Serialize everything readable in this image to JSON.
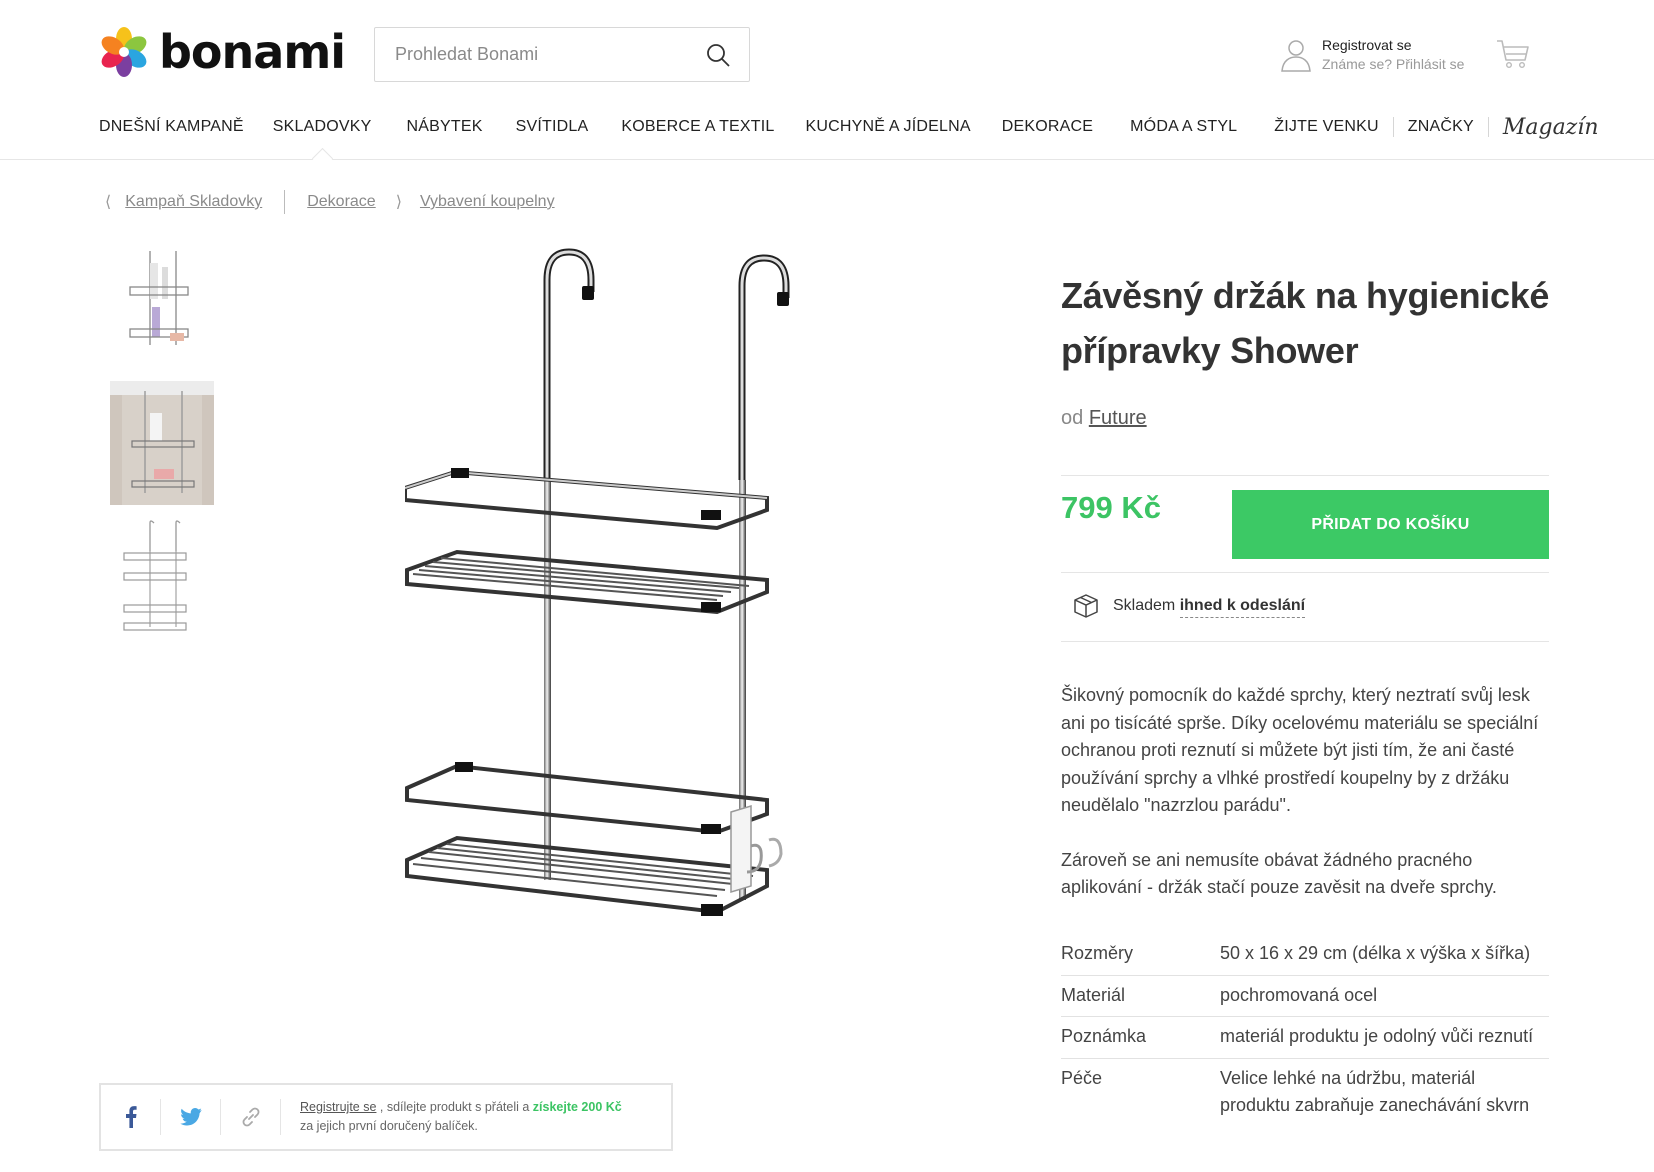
{
  "header": {
    "logo_text": "bonami",
    "search_placeholder": "Prohledat Bonami",
    "account": {
      "register": "Registrovat se",
      "login": "Známe se? Přihlásit se"
    }
  },
  "nav": {
    "items": [
      "DNEŠNÍ KAMPANĚ",
      "SKLADOVKY",
      "NÁBYTEK",
      "SVÍTIDLA",
      "KOBERCE A TEXTIL",
      "KUCHYNĚ A JÍDELNA",
      "DEKORACE",
      "MÓDA A STYL",
      "ŽIJTE VENKU",
      "ZNAČKY",
      "Magazín"
    ],
    "active": "SKLADOVKY"
  },
  "breadcrumb": {
    "back": "Kampaň Skladovky",
    "path": [
      "Dekorace",
      "Vybavení koupelny"
    ]
  },
  "product": {
    "title": "Závěsný držák na hygienické přípravky Shower",
    "brand_prefix": "od",
    "brand": "Future",
    "price": "799 Kč",
    "add_to_cart": "PŘIDAT DO KOŠÍKU",
    "stock_label": "Skladem",
    "stock_status": "ihned k odeslání",
    "description": [
      "Šikovný pomocník do každé sprchy, který neztratí svůj lesk ani po tisícáté sprše. Díky ocelovému materiálu se speciální ochranou proti reznutí si můžete být jisti tím, že ani časté používání sprchy a vlhké prostředí koupelny by z držáku neudělalo \"nazrzlou parádu\".",
      "Zároveň se ani nemusíte obávat žádného pracného aplikování - držák stačí pouze zavěsit na dveře sprchy."
    ],
    "specs": [
      {
        "key": "Rozměry",
        "value": "50 x 16 x 29 cm (délka x výška x šířka)"
      },
      {
        "key": "Materiál",
        "value": "pochromovaná ocel"
      },
      {
        "key": "Poznámka",
        "value": "materiál produktu je odolný vůči reznutí"
      },
      {
        "key": "Péče",
        "value": "Velice lehké na údržbu, materiál produktu zabraňuje zanechávání skvrn"
      }
    ]
  },
  "share": {
    "register_link": "Registrujte se",
    "text_middle": " , sdílejte produkt s přáteli a ",
    "reward": "získejte 200 Kč",
    "text_line2": "za jejich první doručený balíček."
  },
  "colors": {
    "accent_green": "#3cc965",
    "price_green": "#3cc464"
  },
  "icons": [
    "search-icon",
    "user-icon",
    "cart-icon",
    "package-icon",
    "facebook-icon",
    "twitter-icon",
    "link-icon"
  ]
}
